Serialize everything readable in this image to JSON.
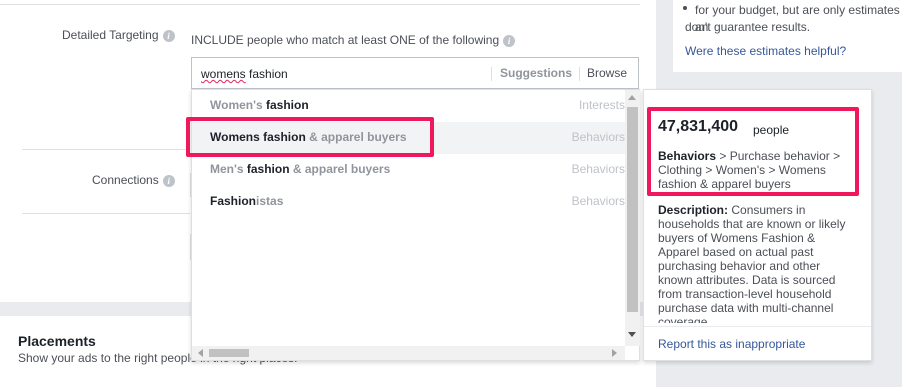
{
  "right_panel": {
    "estimate_note_line1": "for your budget, but are only estimates an",
    "estimate_note_line2": "don't guarantee results.",
    "helpful_link": "Were these estimates helpful?"
  },
  "detailed_targeting": {
    "label": "Detailed Targeting",
    "info_icon": "info-icon",
    "include_text": "INCLUDE people who match at least ONE of the following",
    "search": {
      "value_typo": "womens",
      "value_rest": " fashion",
      "suggestions_label": "Suggestions",
      "browse_label": "Browse"
    },
    "results": [
      {
        "dim": "Women's ",
        "strong": "fashion",
        "tail": "",
        "type": "Interests"
      },
      {
        "dim": "",
        "strong": "Womens fashion",
        "tail": " & apparel buyers",
        "type": "Behaviors"
      },
      {
        "dim": "Men's ",
        "strong": "fashion",
        "tail": " & apparel buyers",
        "type": "Behaviors"
      },
      {
        "dim": "",
        "strong": "Fashion",
        "tail": "istas",
        "type": "Behaviors"
      }
    ]
  },
  "connections": {
    "label": "Connections"
  },
  "detail_card": {
    "audience_size": "47,831,400",
    "audience_unit": "people",
    "path_root": "Behaviors",
    "path_rest": " > Purchase behavior > Clothing > Women's > Womens fashion & apparel buyers",
    "description_label": "Description:",
    "description_text": " Consumers in households that are known or likely buyers of Womens Fashion & Apparel based on actual past purchasing behavior and other known attributes. Data is sourced from transaction-level household purchase data with multi-channel coverage.",
    "report_link": "Report this as inappropriate"
  },
  "placements": {
    "title": "Placements",
    "subtitle": "Show your ads to the right people in the right places."
  },
  "colors": {
    "highlight": "#f0185c",
    "link": "#365899",
    "muted": "#90949c"
  }
}
